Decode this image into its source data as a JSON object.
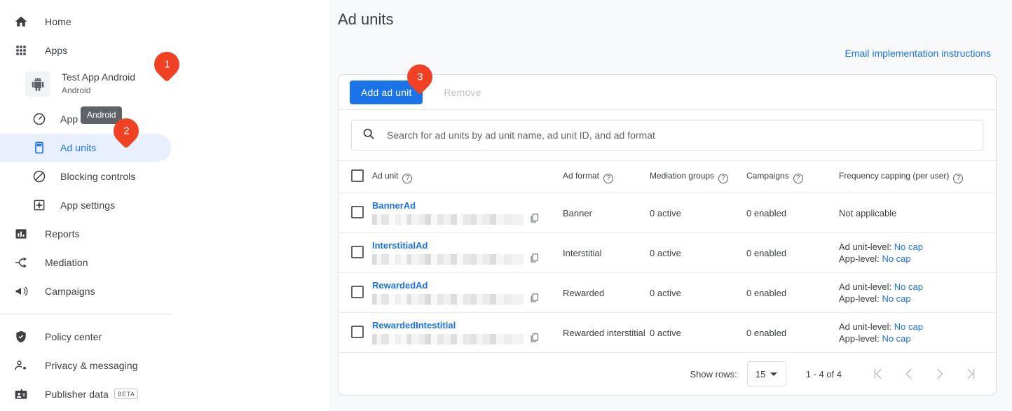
{
  "sidebar": {
    "items_top": [
      {
        "label": "Home",
        "icon": "home-icon",
        "key": "home"
      },
      {
        "label": "Apps",
        "icon": "apps-grid-icon",
        "key": "apps"
      }
    ],
    "app": {
      "name": "Test App Android",
      "platform": "Android",
      "icon": "android-robot-icon"
    },
    "app_subitems": [
      {
        "label": "App overview",
        "icon": "speedometer-icon",
        "key": "app-overview",
        "active": false
      },
      {
        "label": "Ad units",
        "icon": "ad-unit-icon",
        "key": "ad-units",
        "active": true
      },
      {
        "label": "Blocking controls",
        "icon": "block-icon",
        "key": "blocking-controls",
        "active": false
      },
      {
        "label": "App settings",
        "icon": "settings-square-icon",
        "key": "app-settings",
        "active": false
      }
    ],
    "items_mid": [
      {
        "label": "Reports",
        "icon": "bar-chart-icon",
        "key": "reports"
      },
      {
        "label": "Mediation",
        "icon": "mediation-icon",
        "key": "mediation"
      },
      {
        "label": "Campaigns",
        "icon": "megaphone-icon",
        "key": "campaigns"
      }
    ],
    "items_bottom": [
      {
        "label": "Policy center",
        "icon": "shield-check-icon",
        "key": "policy-center",
        "badge": ""
      },
      {
        "label": "Privacy & messaging",
        "icon": "person-privacy-icon",
        "key": "privacy-messaging",
        "badge": ""
      },
      {
        "label": "Publisher data",
        "icon": "id-card-icon",
        "key": "publisher-data",
        "badge": "BETA"
      }
    ],
    "tooltip": "Android"
  },
  "main": {
    "page_title": "Ad units",
    "email_link": "Email implementation instructions",
    "toolbar": {
      "add_label": "Add ad unit",
      "remove_label": "Remove"
    },
    "search": {
      "placeholder": "Search for ad units by ad unit name, ad unit ID, and ad format",
      "value": "",
      "icon": "search-icon"
    },
    "table": {
      "columns": [
        {
          "label": "Ad unit",
          "help": true
        },
        {
          "label": "Ad format",
          "help": true
        },
        {
          "label": "Mediation groups",
          "help": true
        },
        {
          "label": "Campaigns",
          "help": true
        },
        {
          "label": "Frequency capping (per user)",
          "help": true
        }
      ],
      "rows": [
        {
          "name": "BannerAd",
          "id_redacted": true,
          "format": "Banner",
          "mediation_groups": "0 active",
          "campaigns": "0 enabled",
          "freq_not_applicable": "Not applicable",
          "freq_unit_label": "",
          "freq_unit_value": "",
          "freq_app_label": "",
          "freq_app_value": ""
        },
        {
          "name": "InterstitialAd",
          "id_redacted": true,
          "format": "Interstitial",
          "mediation_groups": "0 active",
          "campaigns": "0 enabled",
          "freq_not_applicable": "",
          "freq_unit_label": "Ad unit-level:",
          "freq_unit_value": "No cap",
          "freq_app_label": "App-level:",
          "freq_app_value": "No cap"
        },
        {
          "name": "RewardedAd",
          "id_redacted": true,
          "format": "Rewarded",
          "mediation_groups": "0 active",
          "campaigns": "0 enabled",
          "freq_not_applicable": "",
          "freq_unit_label": "Ad unit-level:",
          "freq_unit_value": "No cap",
          "freq_app_label": "App-level:",
          "freq_app_value": "No cap"
        },
        {
          "name": "RewardedIntestitial",
          "id_redacted": true,
          "format": "Rewarded interstitial",
          "mediation_groups": "0 active",
          "campaigns": "0 enabled",
          "freq_not_applicable": "",
          "freq_unit_label": "Ad unit-level:",
          "freq_unit_value": "No cap",
          "freq_app_label": "App-level:",
          "freq_app_value": "No cap"
        }
      ]
    },
    "pager": {
      "show_rows_label": "Show rows:",
      "rows_value": "15",
      "range": "1 - 4 of 4",
      "first_icon": "first-page-icon",
      "prev_icon": "chevron-left-icon",
      "next_icon": "chevron-right-icon",
      "last_icon": "last-page-icon"
    }
  },
  "annotations": [
    {
      "number": "1",
      "target": "app-row"
    },
    {
      "number": "2",
      "target": "ad-units-nav-item"
    },
    {
      "number": "3",
      "target": "add-ad-unit-button"
    }
  ],
  "colors": {
    "accent_blue": "#1a73e8",
    "badge_orange": "#f04124",
    "active_nav_bg": "#e8f0fe",
    "page_bg": "#f8f9fa",
    "tooltip_bg": "#5f6368"
  }
}
